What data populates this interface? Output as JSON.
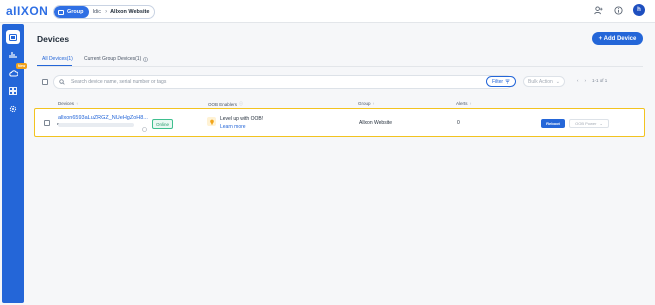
{
  "app": {
    "logo": "aIIXON"
  },
  "breadcrumb": {
    "group_label": "Group",
    "item1": "Idic",
    "current": "Allxon Website"
  },
  "topbar": {
    "avatar_letter": "h"
  },
  "sidebar": {
    "badge": "New"
  },
  "page": {
    "title": "Devices",
    "add_button": "+ Add Device"
  },
  "tabs": [
    {
      "label": "All Devices(1)"
    },
    {
      "label": "Current Group Devices(1)"
    }
  ],
  "toolbar": {
    "search_placeholder": "Search device name, serial number or tags",
    "filter_label": "Filter",
    "bulk_label": "Bulk Action",
    "pager": "1-1 of 1"
  },
  "table": {
    "headers": [
      "Devices",
      "OOB Enablers",
      "Group",
      "Alerts"
    ],
    "rows": [
      {
        "device_name": "allxon6593aLuZRGZ_NUeHgZoH8...",
        "status": "Online",
        "oob_title": "Level up with OOB!",
        "oob_link": "Learn more",
        "group": "Allxon Website",
        "alerts": "0",
        "reboot": "Reboot",
        "oob_power": "OOB Power"
      }
    ]
  },
  "colors": {
    "primary": "#2466d8",
    "highlight": "#f2c320",
    "online": "#3fbf8f"
  }
}
